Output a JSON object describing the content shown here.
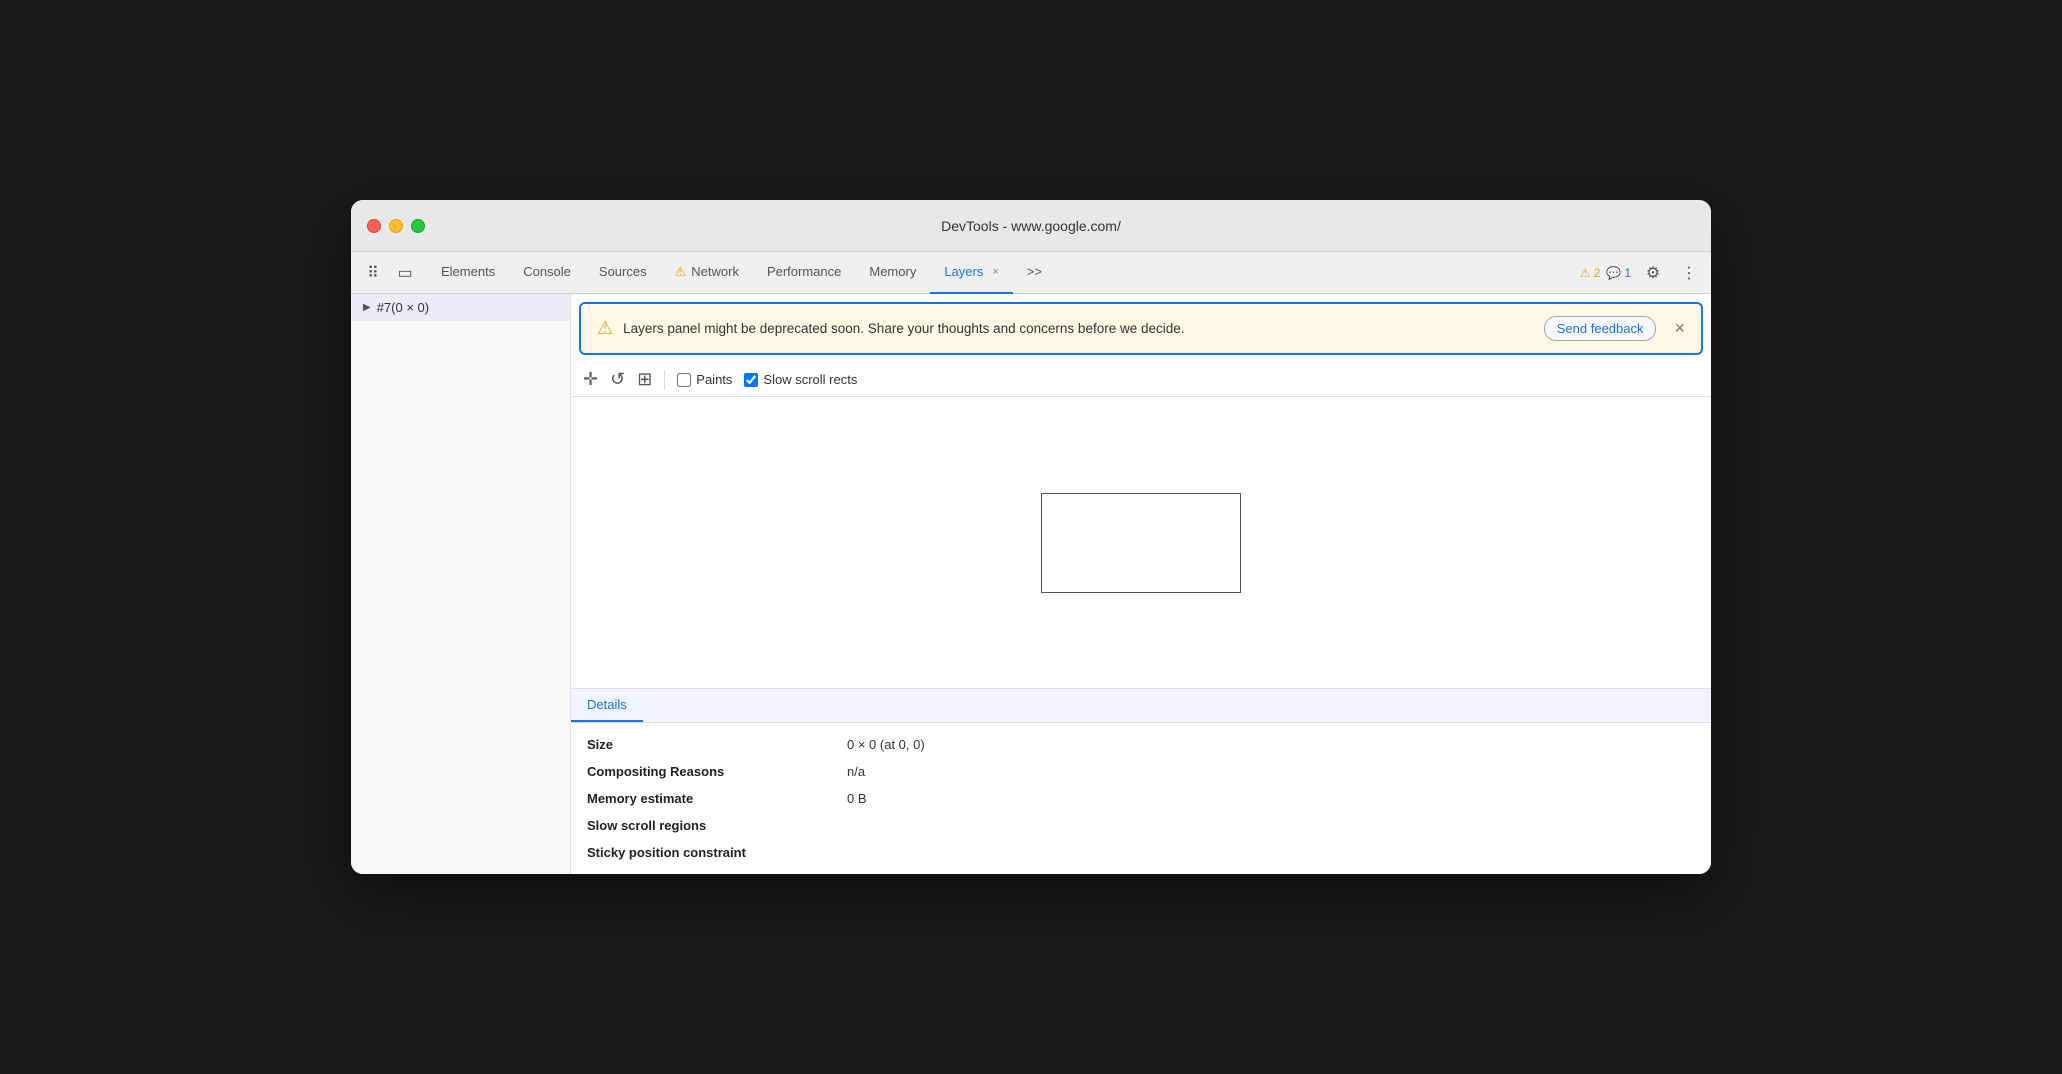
{
  "window": {
    "title": "DevTools - www.google.com/"
  },
  "tabs": {
    "items": [
      {
        "label": "Elements",
        "active": false,
        "icon": null
      },
      {
        "label": "Console",
        "active": false,
        "icon": null
      },
      {
        "label": "Sources",
        "active": false,
        "icon": null
      },
      {
        "label": "Network",
        "active": false,
        "icon": "⚠️"
      },
      {
        "label": "Performance",
        "active": false,
        "icon": null
      },
      {
        "label": "Memory",
        "active": false,
        "icon": null
      },
      {
        "label": "Layers",
        "active": true,
        "icon": null,
        "close": true
      }
    ],
    "more_label": ">>",
    "warning_count": "2",
    "info_count": "1"
  },
  "sidebar": {
    "item_label": "#7(0 × 0)"
  },
  "banner": {
    "message": "Layers panel might be deprecated soon. Share your thoughts and concerns before we decide.",
    "send_feedback_label": "Send feedback",
    "close_icon": "×"
  },
  "toolbar": {
    "paints_label": "Paints",
    "slow_scroll_rects_label": "Slow scroll rects",
    "paints_checked": false,
    "slow_scroll_checked": true
  },
  "details": {
    "tab_label": "Details",
    "rows": [
      {
        "key": "Size",
        "value": "0 × 0 (at 0, 0)"
      },
      {
        "key": "Compositing Reasons",
        "value": "n/a"
      },
      {
        "key": "Memory estimate",
        "value": "0 B"
      },
      {
        "key": "Slow scroll regions",
        "value": ""
      },
      {
        "key": "Sticky position constraint",
        "value": ""
      }
    ]
  }
}
